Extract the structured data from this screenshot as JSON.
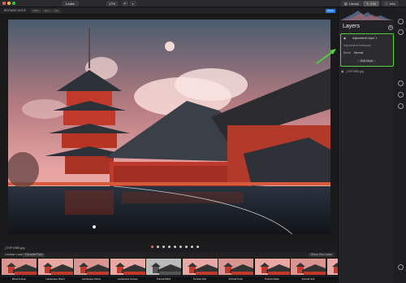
{
  "window": {
    "app_name": "Looks",
    "zoom": "17%"
  },
  "subbar": {
    "label": "BROWSE MODE",
    "pills": [
      "Filter",
      "Sort",
      "Info"
    ],
    "save_label": "Done"
  },
  "top_tabs": {
    "library": "Library",
    "edit": "Edit",
    "info": "Info"
  },
  "file": {
    "name": "_DSF1985.jpg"
  },
  "pager": {
    "count": 9,
    "active": 0
  },
  "strip_tabs": [
    "Luminar Looks",
    "Favorite Pack"
  ],
  "strip_right": "Show Our Looks",
  "looks": [
    {
      "label": "Mood Fusion"
    },
    {
      "label": "Landscape Bright"
    },
    {
      "label": "Landscape Warm"
    },
    {
      "label": "Landscape Sunset"
    },
    {
      "label": "Portrait B&W"
    },
    {
      "label": "Portrait Soft"
    },
    {
      "label": "Portrait Color"
    },
    {
      "label": "Portrait Matte"
    },
    {
      "label": "Portrait Soft"
    },
    {
      "label": "Top Channel"
    }
  ],
  "layers": {
    "title": "Layers",
    "card": {
      "name": "Adjustment Layer 1",
      "sub": "Adjustment Ambiance",
      "blend_label": "Blend",
      "blend_value": "Normal",
      "edit_label": "Edit More"
    },
    "base_layer": "_DSF1985.jpg"
  },
  "colors": {
    "accent": "#2f7de1",
    "highlight": "#4fd13a"
  }
}
